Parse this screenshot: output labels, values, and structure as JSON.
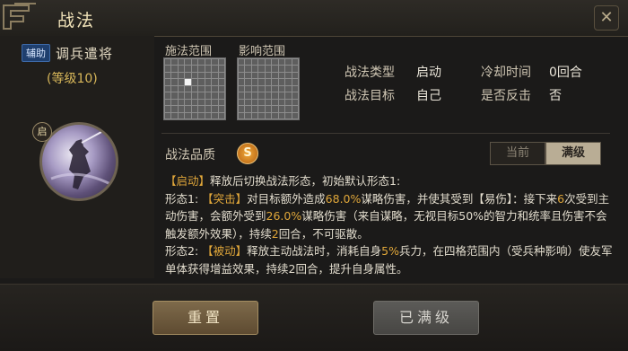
{
  "window": {
    "title": "战法",
    "close_icon": "close-icon"
  },
  "skill": {
    "type_badge": "辅助",
    "name": "调兵遣将",
    "level": "(等级10)",
    "start_tag": "启"
  },
  "grids": {
    "cast_range_label": "施法范围",
    "effect_range_label": "影响范围"
  },
  "info": {
    "type_label": "战法类型",
    "type_value": "启动",
    "cooldown_label": "冷却时间",
    "cooldown_value": "0回合",
    "target_label": "战法目标",
    "target_value": "自己",
    "counter_label": "是否反击",
    "counter_value": "否"
  },
  "quality": {
    "label": "战法品质",
    "value": "S"
  },
  "level_toggle": {
    "current": "当前",
    "max": "满级",
    "selected": "满级"
  },
  "description": {
    "line1_tag": "【启动】",
    "line1_text": "释放后切换战法形态，初始默认形态1:",
    "f1_prefix": "形态1: ",
    "f1_tag": "【突击】",
    "f1_a": "对目标额外造成",
    "f1_num1": "68.0%",
    "f1_b": "谋略伤害，并使其受到【易伤】：接下来",
    "f1_num2": "6",
    "f1_c": "次受到主动伤害，会额外受到",
    "f1_num3": "26.0%",
    "f1_d": "谋略伤害（来自谋略，无视目标50%的智力和统率且伤害不会触发额外效果），持续",
    "f1_num4": "2",
    "f1_e": "回合，不可驱散。",
    "f2_prefix": "形态2: ",
    "f2_tag": "【被动】",
    "f2_a": "释放主动战法时，消耗自身",
    "f2_num1": "5%",
    "f2_b": "兵力，在四格范围内（受兵种",
    "f2_c": "影响）使友军单体获得增益效果，持续2回合，提升自身属性。"
  },
  "buttons": {
    "reset": "重置",
    "maxed": "已满级"
  }
}
